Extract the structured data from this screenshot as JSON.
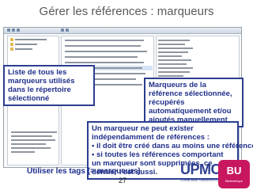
{
  "slide": {
    "title": "Gérer les références : marqueurs",
    "page_number": "27"
  },
  "callouts": {
    "left": "Liste de tous les marqueurs utilisés dans le répertoire sélectionné",
    "right": "Marqueurs de la référence sélectionnée, récupérés automatiquement et/ou ajoutés manuellement",
    "middle": {
      "intro": "Un marqueur ne peut exister indépendamment de références :",
      "bullets": [
        "il doit être créé dans au moins une référence ;",
        "si toutes les références comportant un marqueur sont supprimées, ce dernier l'est aussi."
      ]
    }
  },
  "caption": "Utiliser les tags (= marqueurs)",
  "logos": {
    "upmc": "UPMC",
    "upmc_sub": "SORBONNE UNIVERSITÉS",
    "badge": "BU",
    "badge_sub": "Bibliothèque"
  },
  "colors": {
    "callout_border": "#2b3e8f",
    "callout_text": "#1f2f8a",
    "title": "#5a5a5a",
    "badge": "#c8175f"
  }
}
